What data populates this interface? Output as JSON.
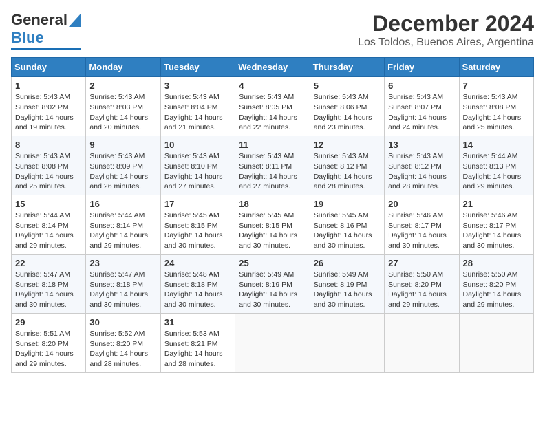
{
  "logo": {
    "line1": "General",
    "line2": "Blue"
  },
  "title": "December 2024",
  "subtitle": "Los Toldos, Buenos Aires, Argentina",
  "days_of_week": [
    "Sunday",
    "Monday",
    "Tuesday",
    "Wednesday",
    "Thursday",
    "Friday",
    "Saturday"
  ],
  "weeks": [
    [
      {
        "day": "1",
        "lines": [
          "Sunrise: 5:43 AM",
          "Sunset: 8:02 PM",
          "Daylight: 14 hours",
          "and 19 minutes."
        ]
      },
      {
        "day": "2",
        "lines": [
          "Sunrise: 5:43 AM",
          "Sunset: 8:03 PM",
          "Daylight: 14 hours",
          "and 20 minutes."
        ]
      },
      {
        "day": "3",
        "lines": [
          "Sunrise: 5:43 AM",
          "Sunset: 8:04 PM",
          "Daylight: 14 hours",
          "and 21 minutes."
        ]
      },
      {
        "day": "4",
        "lines": [
          "Sunrise: 5:43 AM",
          "Sunset: 8:05 PM",
          "Daylight: 14 hours",
          "and 22 minutes."
        ]
      },
      {
        "day": "5",
        "lines": [
          "Sunrise: 5:43 AM",
          "Sunset: 8:06 PM",
          "Daylight: 14 hours",
          "and 23 minutes."
        ]
      },
      {
        "day": "6",
        "lines": [
          "Sunrise: 5:43 AM",
          "Sunset: 8:07 PM",
          "Daylight: 14 hours",
          "and 24 minutes."
        ]
      },
      {
        "day": "7",
        "lines": [
          "Sunrise: 5:43 AM",
          "Sunset: 8:08 PM",
          "Daylight: 14 hours",
          "and 25 minutes."
        ]
      }
    ],
    [
      {
        "day": "8",
        "lines": [
          "Sunrise: 5:43 AM",
          "Sunset: 8:08 PM",
          "Daylight: 14 hours",
          "and 25 minutes."
        ]
      },
      {
        "day": "9",
        "lines": [
          "Sunrise: 5:43 AM",
          "Sunset: 8:09 PM",
          "Daylight: 14 hours",
          "and 26 minutes."
        ]
      },
      {
        "day": "10",
        "lines": [
          "Sunrise: 5:43 AM",
          "Sunset: 8:10 PM",
          "Daylight: 14 hours",
          "and 27 minutes."
        ]
      },
      {
        "day": "11",
        "lines": [
          "Sunrise: 5:43 AM",
          "Sunset: 8:11 PM",
          "Daylight: 14 hours",
          "and 27 minutes."
        ]
      },
      {
        "day": "12",
        "lines": [
          "Sunrise: 5:43 AM",
          "Sunset: 8:12 PM",
          "Daylight: 14 hours",
          "and 28 minutes."
        ]
      },
      {
        "day": "13",
        "lines": [
          "Sunrise: 5:43 AM",
          "Sunset: 8:12 PM",
          "Daylight: 14 hours",
          "and 28 minutes."
        ]
      },
      {
        "day": "14",
        "lines": [
          "Sunrise: 5:44 AM",
          "Sunset: 8:13 PM",
          "Daylight: 14 hours",
          "and 29 minutes."
        ]
      }
    ],
    [
      {
        "day": "15",
        "lines": [
          "Sunrise: 5:44 AM",
          "Sunset: 8:14 PM",
          "Daylight: 14 hours",
          "and 29 minutes."
        ]
      },
      {
        "day": "16",
        "lines": [
          "Sunrise: 5:44 AM",
          "Sunset: 8:14 PM",
          "Daylight: 14 hours",
          "and 29 minutes."
        ]
      },
      {
        "day": "17",
        "lines": [
          "Sunrise: 5:45 AM",
          "Sunset: 8:15 PM",
          "Daylight: 14 hours",
          "and 30 minutes."
        ]
      },
      {
        "day": "18",
        "lines": [
          "Sunrise: 5:45 AM",
          "Sunset: 8:15 PM",
          "Daylight: 14 hours",
          "and 30 minutes."
        ]
      },
      {
        "day": "19",
        "lines": [
          "Sunrise: 5:45 AM",
          "Sunset: 8:16 PM",
          "Daylight: 14 hours",
          "and 30 minutes."
        ]
      },
      {
        "day": "20",
        "lines": [
          "Sunrise: 5:46 AM",
          "Sunset: 8:17 PM",
          "Daylight: 14 hours",
          "and 30 minutes."
        ]
      },
      {
        "day": "21",
        "lines": [
          "Sunrise: 5:46 AM",
          "Sunset: 8:17 PM",
          "Daylight: 14 hours",
          "and 30 minutes."
        ]
      }
    ],
    [
      {
        "day": "22",
        "lines": [
          "Sunrise: 5:47 AM",
          "Sunset: 8:18 PM",
          "Daylight: 14 hours",
          "and 30 minutes."
        ]
      },
      {
        "day": "23",
        "lines": [
          "Sunrise: 5:47 AM",
          "Sunset: 8:18 PM",
          "Daylight: 14 hours",
          "and 30 minutes."
        ]
      },
      {
        "day": "24",
        "lines": [
          "Sunrise: 5:48 AM",
          "Sunset: 8:18 PM",
          "Daylight: 14 hours",
          "and 30 minutes."
        ]
      },
      {
        "day": "25",
        "lines": [
          "Sunrise: 5:49 AM",
          "Sunset: 8:19 PM",
          "Daylight: 14 hours",
          "and 30 minutes."
        ]
      },
      {
        "day": "26",
        "lines": [
          "Sunrise: 5:49 AM",
          "Sunset: 8:19 PM",
          "Daylight: 14 hours",
          "and 30 minutes."
        ]
      },
      {
        "day": "27",
        "lines": [
          "Sunrise: 5:50 AM",
          "Sunset: 8:20 PM",
          "Daylight: 14 hours",
          "and 29 minutes."
        ]
      },
      {
        "day": "28",
        "lines": [
          "Sunrise: 5:50 AM",
          "Sunset: 8:20 PM",
          "Daylight: 14 hours",
          "and 29 minutes."
        ]
      }
    ],
    [
      {
        "day": "29",
        "lines": [
          "Sunrise: 5:51 AM",
          "Sunset: 8:20 PM",
          "Daylight: 14 hours",
          "and 29 minutes."
        ]
      },
      {
        "day": "30",
        "lines": [
          "Sunrise: 5:52 AM",
          "Sunset: 8:20 PM",
          "Daylight: 14 hours",
          "and 28 minutes."
        ]
      },
      {
        "day": "31",
        "lines": [
          "Sunrise: 5:53 AM",
          "Sunset: 8:21 PM",
          "Daylight: 14 hours",
          "and 28 minutes."
        ]
      },
      null,
      null,
      null,
      null
    ]
  ]
}
